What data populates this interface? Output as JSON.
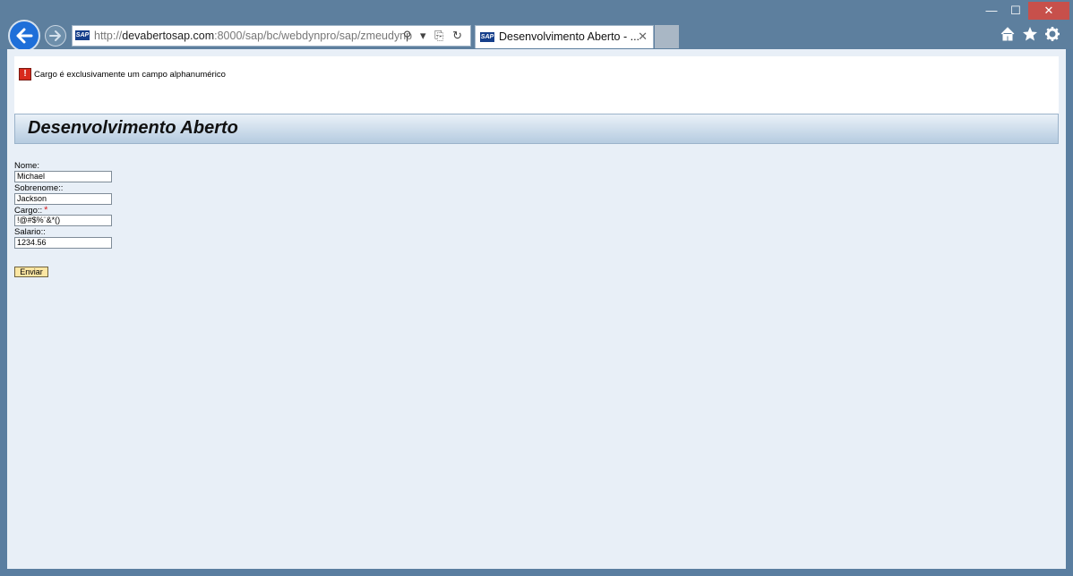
{
  "browser": {
    "address": {
      "scheme": "http://",
      "host": "devabertosap.com",
      "path": ":8000/sap/bc/webdynpro/sap/zmeudynp",
      "tools": "⚲ ▾ ⎘ ↻"
    },
    "tab": {
      "title": "Desenvolvimento Aberto - ...",
      "close": "✕"
    },
    "window": {
      "minimize": "—",
      "maximize": "☐",
      "close": "✕"
    },
    "icons": {
      "home": "home-icon",
      "favorites": "star-icon",
      "tools": "gear-icon"
    },
    "sap_logo_text": "SAP"
  },
  "message": {
    "icon": "!",
    "text": "Cargo é exclusivamente um campo alphanumérico"
  },
  "page": {
    "title": "Desenvolvimento Aberto"
  },
  "form": {
    "nome": {
      "label": "Nome:",
      "value": "Michael"
    },
    "sobrenome": {
      "label": "Sobrenome::",
      "value": "Jackson"
    },
    "cargo": {
      "label": "Cargo::",
      "required_mark": "*",
      "value": "!@#$%¨&*()"
    },
    "salario": {
      "label": "Salario::",
      "value": "1234.56"
    },
    "submit_label": "Enviar"
  },
  "colors": {
    "frame": "#5d7f9e",
    "content_bg": "#e8eff7",
    "error": "#d82a1c",
    "button_bg": "#fbe6a3"
  }
}
